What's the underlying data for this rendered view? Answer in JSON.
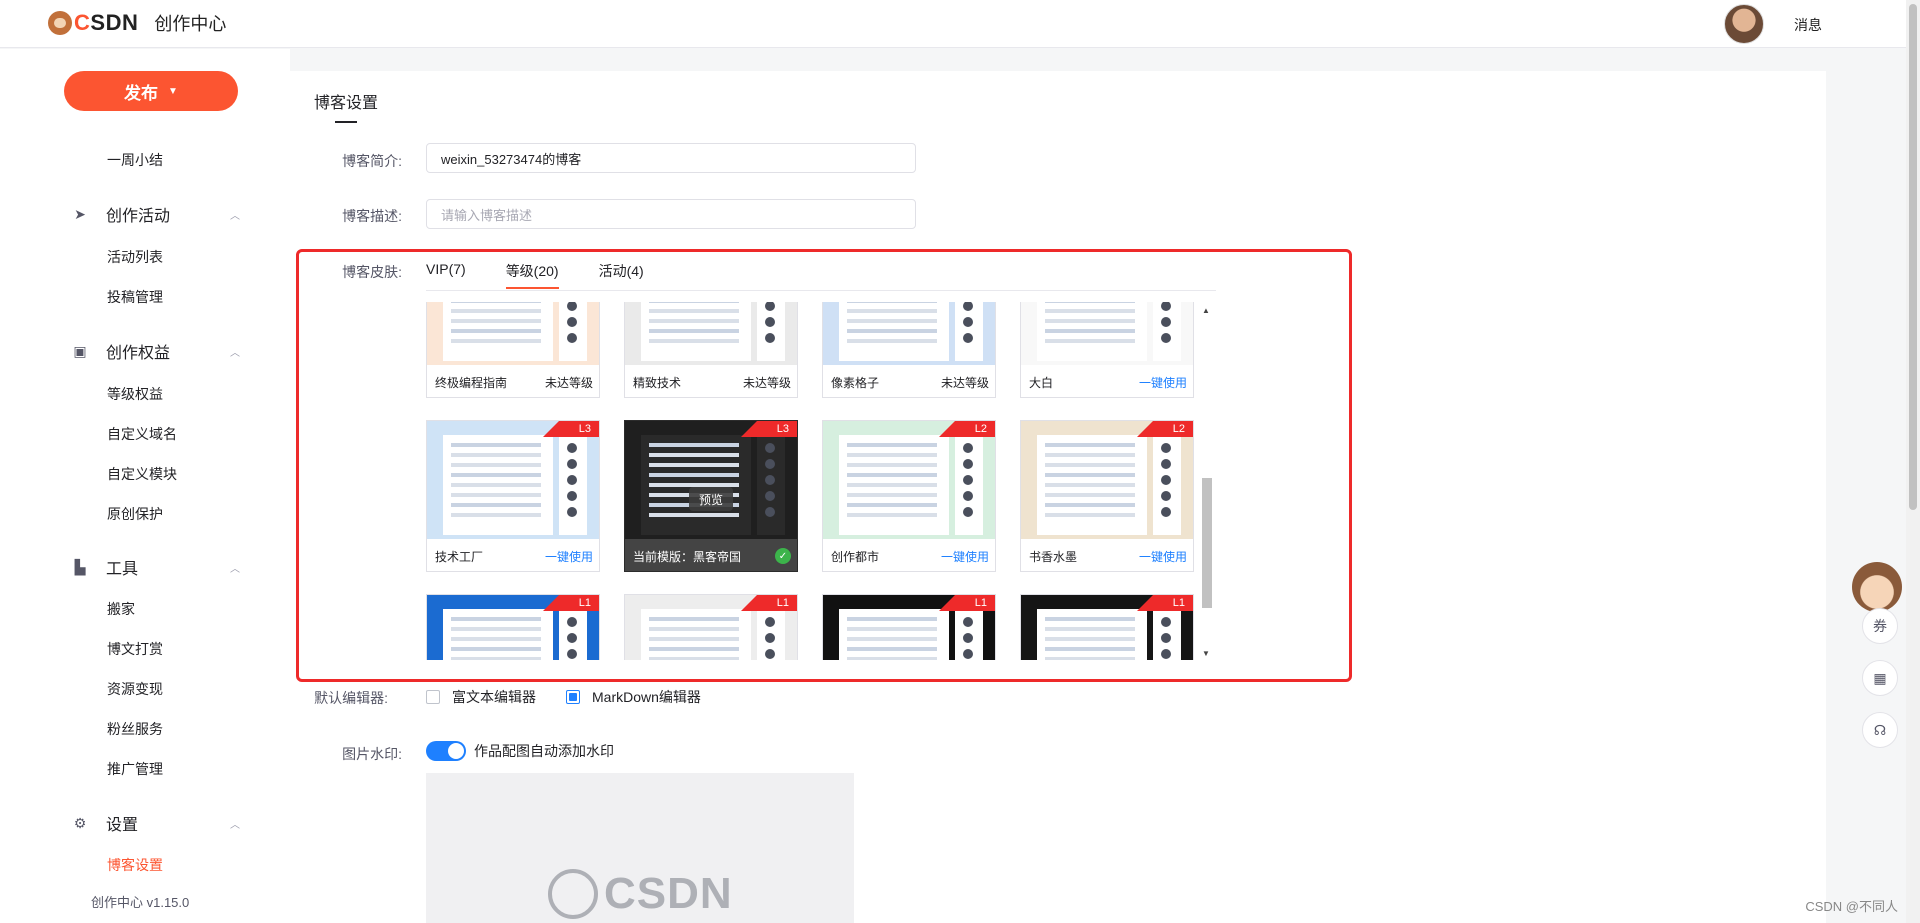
{
  "header": {
    "logo_text": "CSDN",
    "logo_subtitle": "创作中心",
    "message_link": "消息"
  },
  "sidebar": {
    "publish_label": "发布",
    "weekly_summary": "一周小结",
    "groups": [
      {
        "label": "创作活动",
        "icon": "paper-plane-icon",
        "items": [
          "活动列表",
          "投稿管理"
        ]
      },
      {
        "label": "创作权益",
        "icon": "briefcase-icon",
        "items": [
          "等级权益",
          "自定义域名",
          "自定义模块",
          "原创保护"
        ]
      },
      {
        "label": "工具",
        "icon": "stamp-tool-icon",
        "items": [
          "搬家",
          "博文打赏",
          "资源变现",
          "粉丝服务",
          "推广管理"
        ]
      },
      {
        "label": "设置",
        "icon": "gear-icon",
        "items": [
          "博客设置"
        ]
      }
    ],
    "active_item": "博客设置",
    "version": "创作中心 v1.15.0"
  },
  "settings": {
    "title": "博客设置",
    "blog_intro_label": "博客简介:",
    "blog_intro_value": "weixin_53273474的博客",
    "blog_desc_label": "博客描述:",
    "blog_desc_placeholder": "请输入博客描述",
    "skin_label": "博客皮肤:",
    "skin_tabs": [
      "VIP(7)",
      "等级(20)",
      "活动(4)"
    ],
    "active_skin_tab": "等级(20)",
    "skins": [
      {
        "name": "终极编程指南",
        "action": "未达等级",
        "level": ""
      },
      {
        "name": "精致技术",
        "action": "未达等级",
        "level": ""
      },
      {
        "name": "像素格子",
        "action": "未达等级",
        "level": ""
      },
      {
        "name": "大白",
        "action": "一键使用",
        "level": ""
      },
      {
        "name": "技术工厂",
        "action": "一键使用",
        "level": "L3"
      },
      {
        "name": "当前模版：黑客帝国",
        "action": "",
        "level": "L3",
        "preview": "预览"
      },
      {
        "name": "创作都市",
        "action": "一键使用",
        "level": "L2"
      },
      {
        "name": "书香水墨",
        "action": "一键使用",
        "level": "L2"
      },
      {
        "name": "",
        "action": "",
        "level": "L1"
      },
      {
        "name": "",
        "action": "",
        "level": "L1"
      },
      {
        "name": "",
        "action": "",
        "level": "L1"
      },
      {
        "name": "",
        "action": "",
        "level": "L1"
      }
    ],
    "editor_label": "默认编辑器:",
    "editor_options": [
      "富文本编辑器",
      "MarkDown编辑器"
    ],
    "editor_selected": "MarkDown编辑器",
    "watermark_label": "图片水印:",
    "watermark_toggle_text": "作品配图自动添加水印",
    "watermark_enabled": true,
    "watermark_logo": "CSDN"
  },
  "floats": {
    "coupon_icon": "coupon-icon",
    "qr_icon": "qr-code-icon",
    "support_icon": "headset-icon"
  },
  "footer_watermark": "CSDN @不同人",
  "colors": {
    "accent": "#fc5531",
    "link": "#1e80ff",
    "annotation_red": "#ee2a2a"
  }
}
